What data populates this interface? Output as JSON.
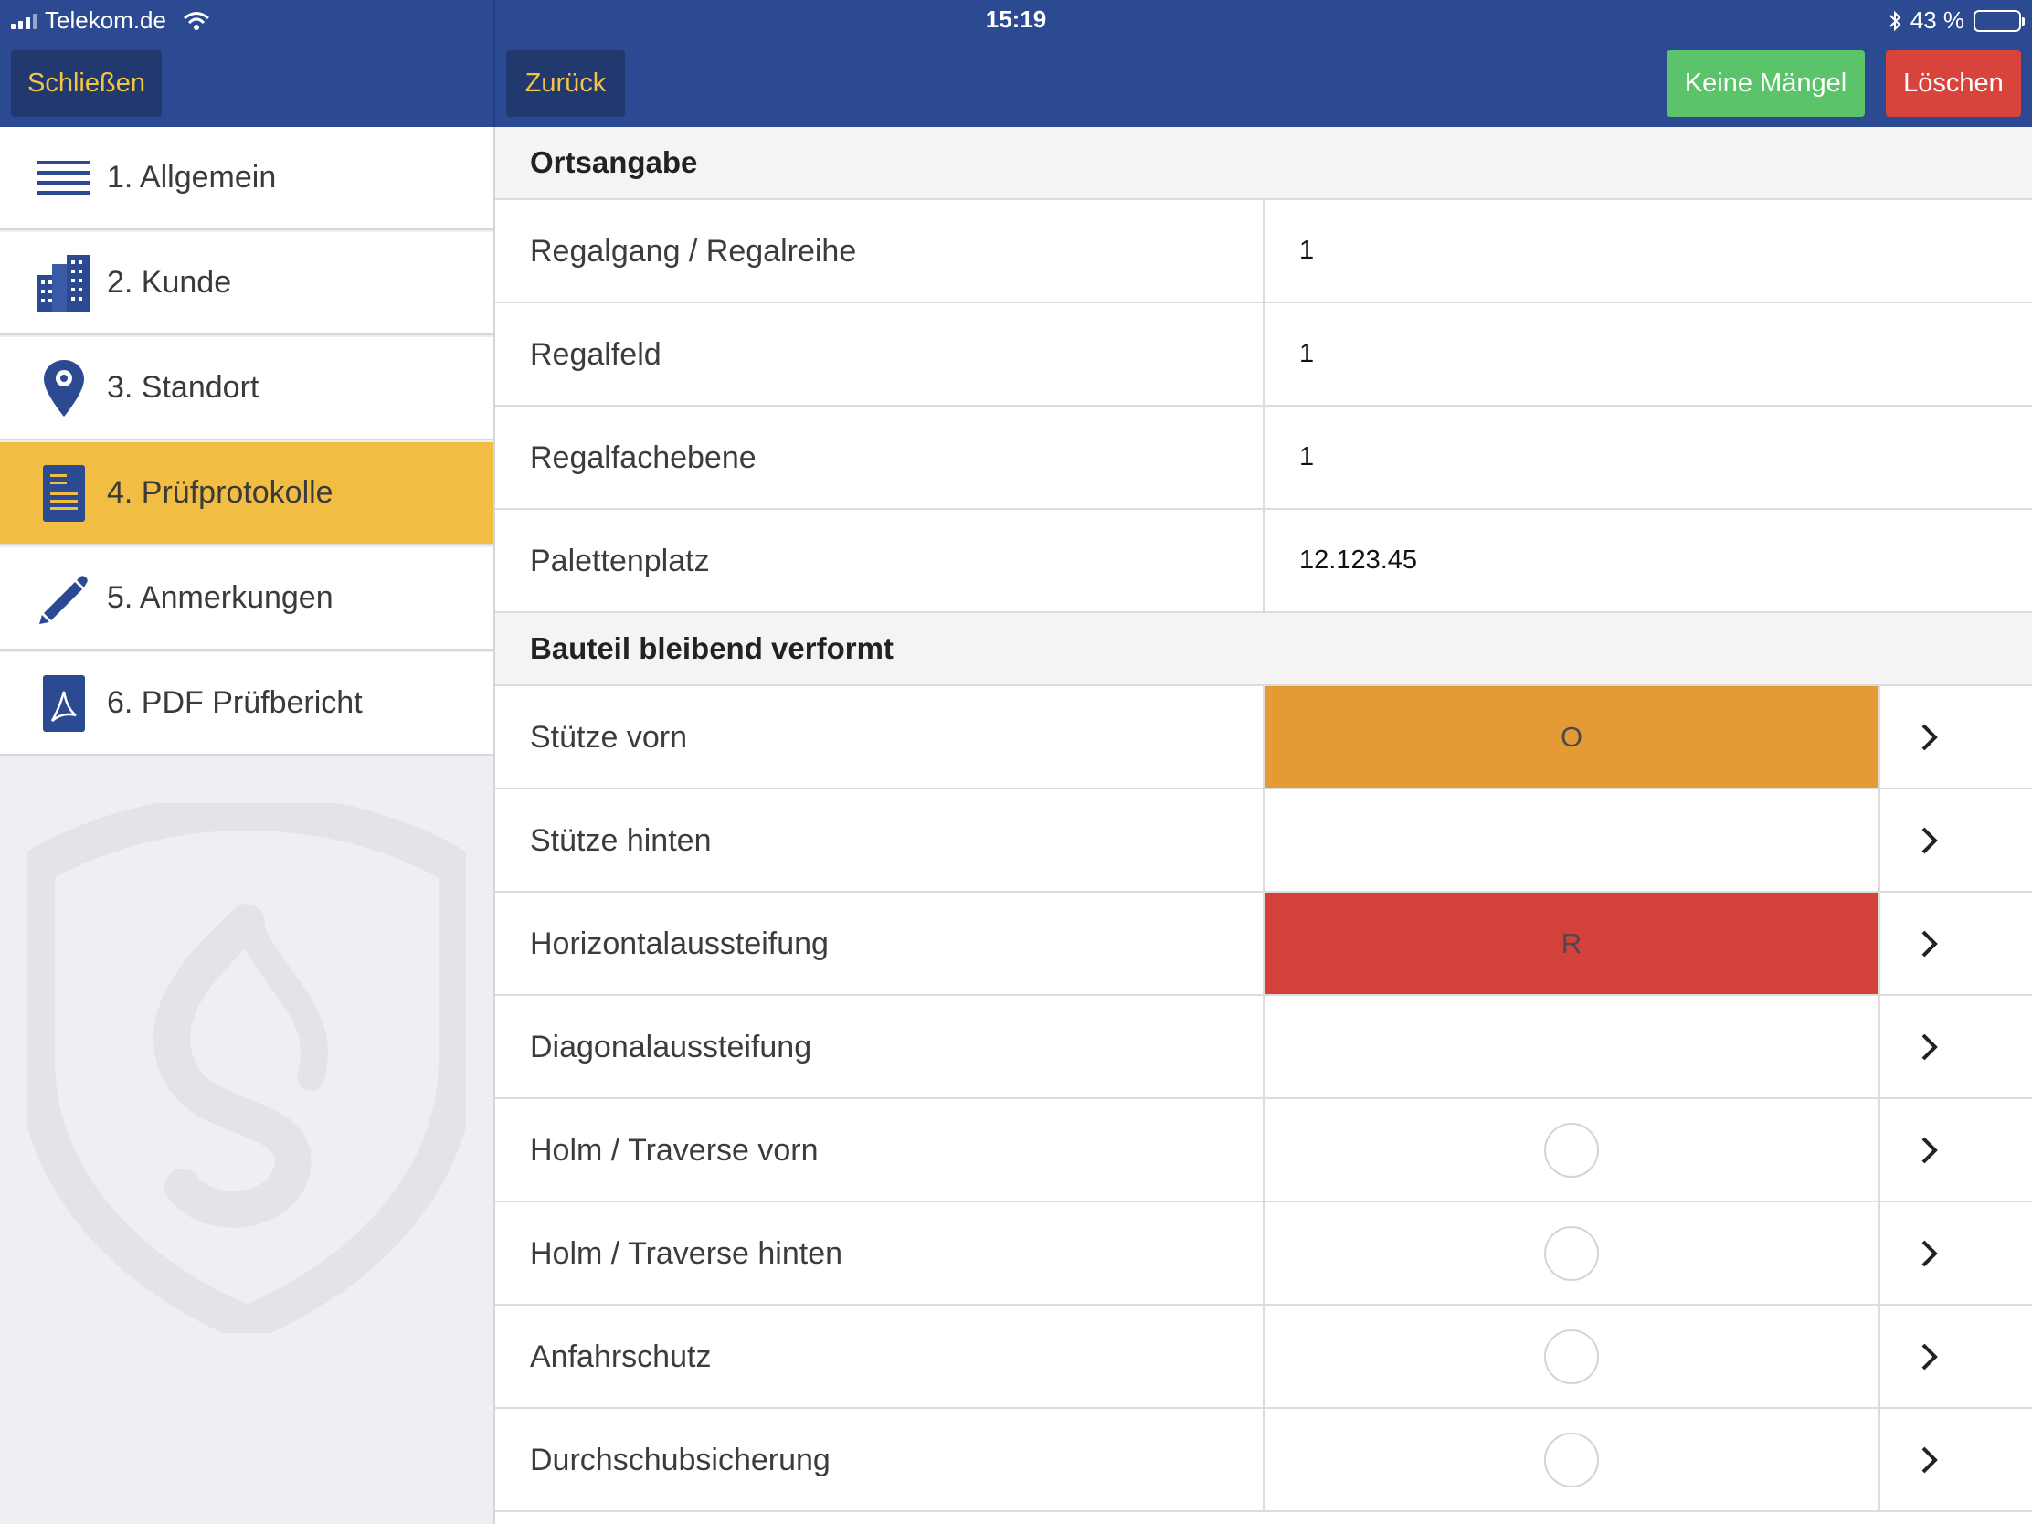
{
  "status_bar": {
    "carrier": "Telekom.de",
    "time": "15:19",
    "battery": "43 %"
  },
  "nav": {
    "close_label": "Schließen",
    "back_label": "Zurück",
    "no_defects_label": "Keine Mängel",
    "delete_label": "Löschen"
  },
  "sidebar": {
    "items": [
      {
        "label": "1. Allgemein",
        "icon": "list-icon"
      },
      {
        "label": "2. Kunde",
        "icon": "buildings-icon"
      },
      {
        "label": "3. Standort",
        "icon": "location-pin-icon"
      },
      {
        "label": "4. Prüfprotokolle",
        "icon": "document-icon",
        "active": true
      },
      {
        "label": "5. Anmerkungen",
        "icon": "pencil-icon"
      },
      {
        "label": "6. PDF Prüfbericht",
        "icon": "pdf-icon"
      }
    ]
  },
  "location": {
    "title": "Ortsangabe",
    "fields": [
      {
        "label": "Regalgang / Regalreihe",
        "value": "1"
      },
      {
        "label": "Regalfeld",
        "value": "1"
      },
      {
        "label": "Regalfachebene",
        "value": "1"
      },
      {
        "label": "Palettenplatz",
        "value": "12.123.45"
      }
    ]
  },
  "component": {
    "title": "Bauteil bleibend verformt",
    "rows": [
      {
        "label": "Stütze vorn",
        "status": "O",
        "color": "#e59a35"
      },
      {
        "label": "Stütze hinten",
        "status": "",
        "color": ""
      },
      {
        "label": "Horizontalaussteifung",
        "status": "R",
        "color": "#d4413a"
      },
      {
        "label": "Diagonalaussteifung",
        "status": "",
        "color": ""
      },
      {
        "label": "Holm / Traverse vorn",
        "status": "circle",
        "color": ""
      },
      {
        "label": "Holm / Traverse hinten",
        "status": "circle",
        "color": ""
      },
      {
        "label": "Anfahrschutz",
        "status": "circle",
        "color": ""
      },
      {
        "label": "Durchschubsicherung",
        "status": "circle",
        "color": ""
      }
    ]
  },
  "colors": {
    "header": "#2c4a92",
    "active": "#f1be43",
    "accent_text": "#f2c443",
    "green": "#5bc36a",
    "red": "#d8433b",
    "icon_blue": "#2c4a92"
  }
}
